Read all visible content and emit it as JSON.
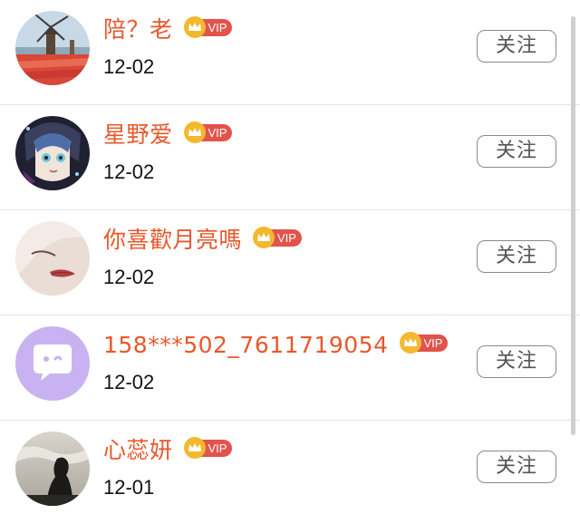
{
  "colors": {
    "name": "#e9572b",
    "vip_tag": "#e2534c",
    "crown": "#f3b92e"
  },
  "users": [
    {
      "name": "陪？老",
      "vip": "VIP",
      "date": "12-02",
      "follow_label": "关注",
      "avatar": "windmill-tulip-field-photo"
    },
    {
      "name": "星野爱",
      "vip": "VIP",
      "date": "12-02",
      "follow_label": "关注",
      "avatar": "anime-character-avatar"
    },
    {
      "name": "你喜歡月亮嗎",
      "vip": "VIP",
      "date": "12-02",
      "follow_label": "关注",
      "avatar": "face-closeup-drawing"
    },
    {
      "name": "158***502_7611719054",
      "vip": "VIP",
      "date": "12-02",
      "follow_label": "关注",
      "avatar": "purple-chat-bubble-icon"
    },
    {
      "name": "心蕊妍",
      "vip": "VIP",
      "date": "12-01",
      "follow_label": "关注",
      "avatar": "silhouette-sky-photo"
    }
  ]
}
